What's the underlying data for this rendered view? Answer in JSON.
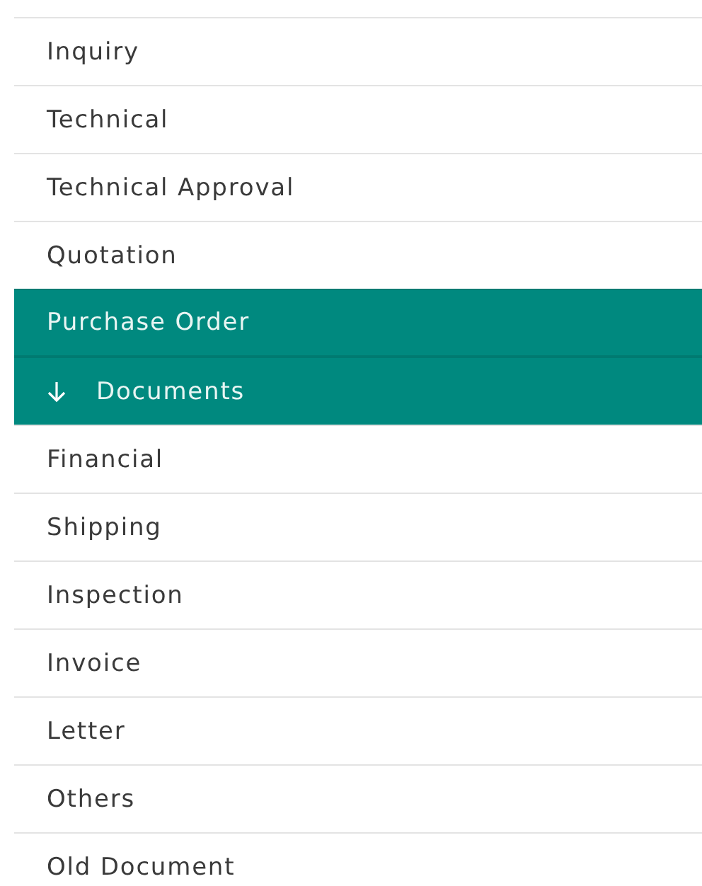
{
  "menu": {
    "items": [
      {
        "label": "Inquiry",
        "selected": false
      },
      {
        "label": "Technical",
        "selected": false
      },
      {
        "label": "Technical Approval",
        "selected": false
      },
      {
        "label": "Quotation",
        "selected": false
      },
      {
        "label": "Purchase Order",
        "selected": true,
        "expanded": true,
        "children": [
          {
            "label": "Documents",
            "selected": true
          }
        ]
      },
      {
        "label": "Financial",
        "selected": false
      },
      {
        "label": "Shipping",
        "selected": false
      },
      {
        "label": "Inspection",
        "selected": false
      },
      {
        "label": "Invoice",
        "selected": false
      },
      {
        "label": "Letter",
        "selected": false
      },
      {
        "label": "Others",
        "selected": false
      },
      {
        "label": "Old Document",
        "selected": false
      }
    ]
  }
}
